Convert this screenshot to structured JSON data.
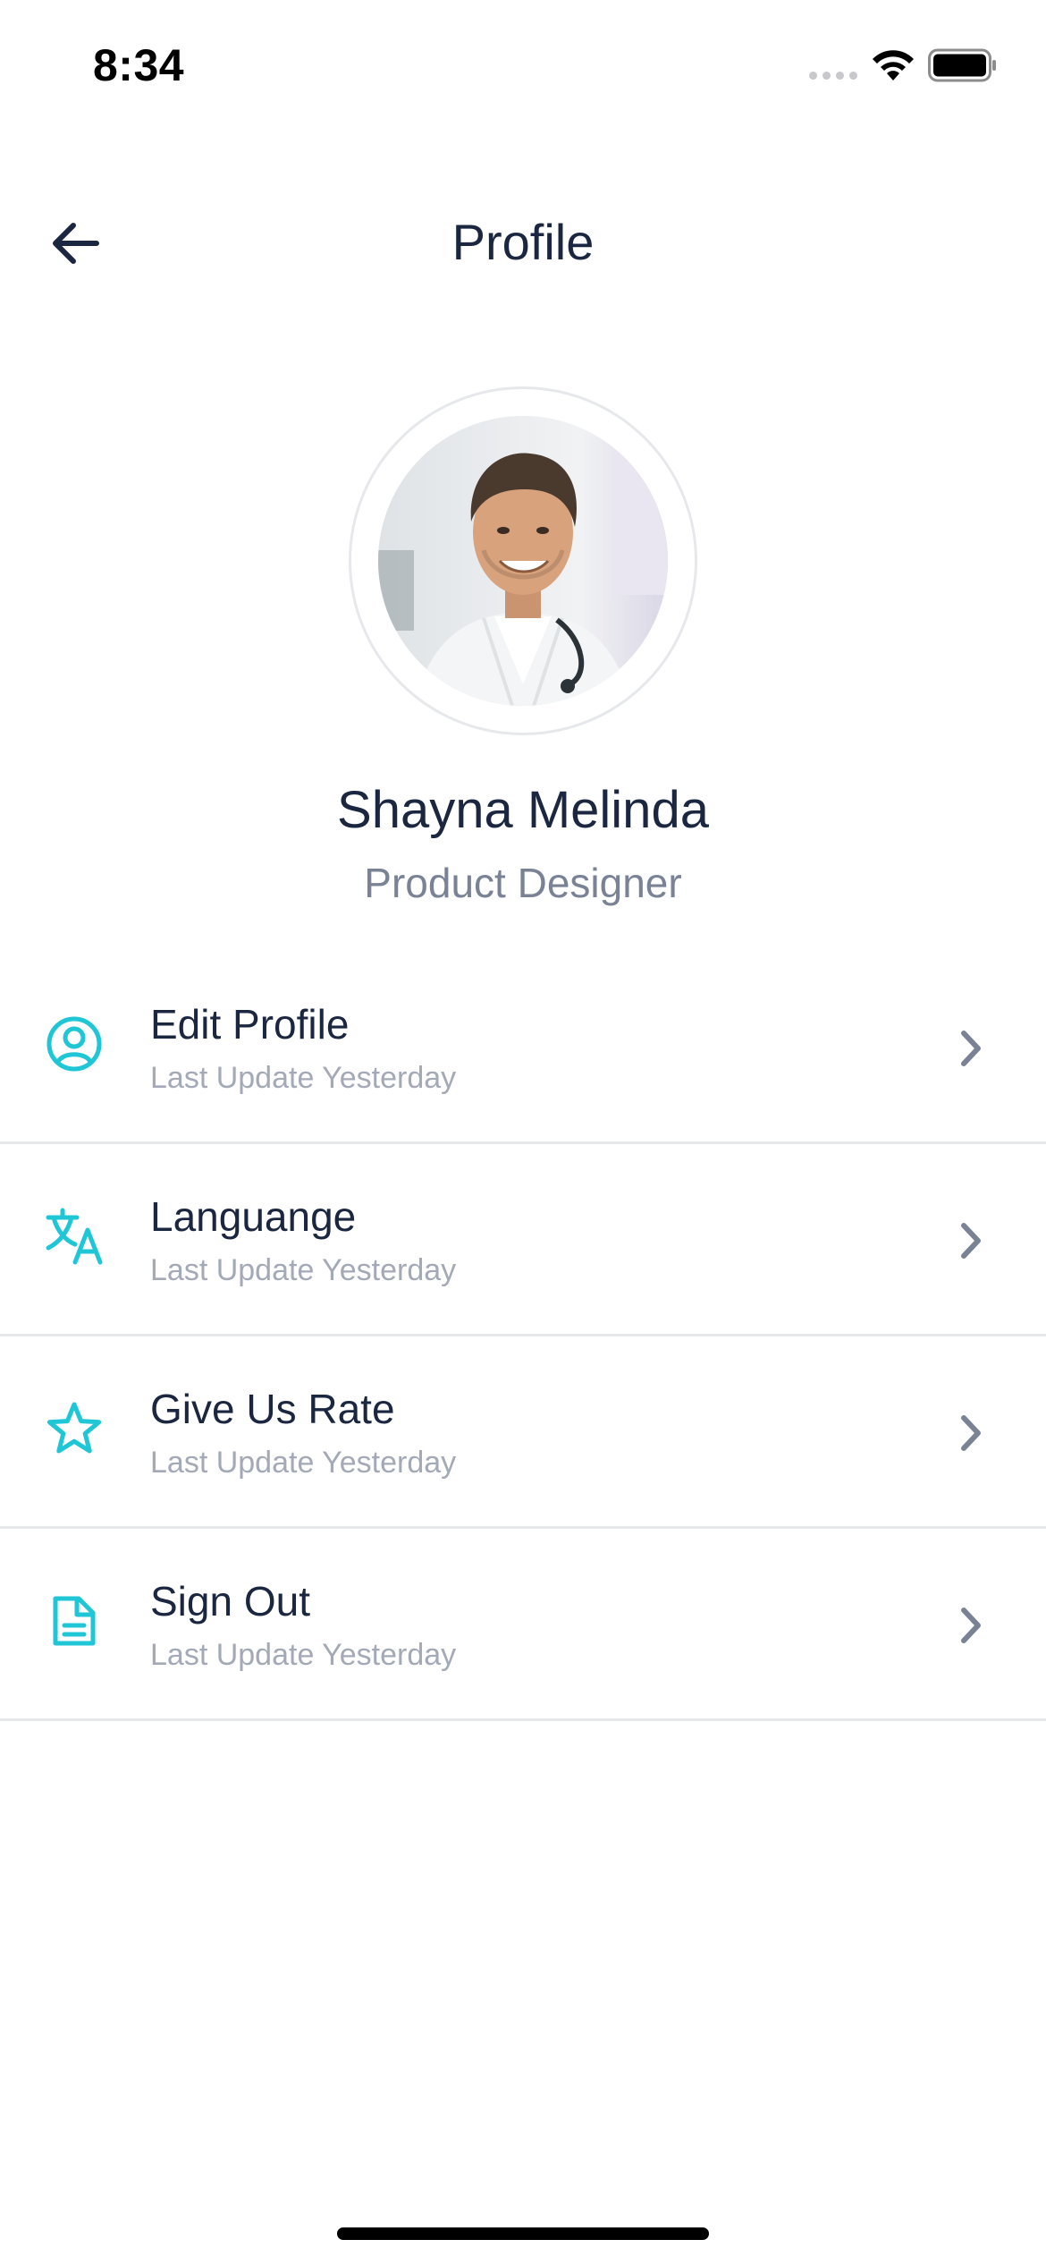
{
  "status_bar": {
    "time": "8:34"
  },
  "header": {
    "title": "Profile"
  },
  "profile": {
    "name": "Shayna Melinda",
    "role": "Product Designer"
  },
  "menu": {
    "items": [
      {
        "title": "Edit Profile",
        "subtitle": "Last Update Yesterday",
        "icon": "user-circle-icon"
      },
      {
        "title": "Languange",
        "subtitle": "Last Update Yesterday",
        "icon": "translate-icon"
      },
      {
        "title": "Give Us Rate",
        "subtitle": "Last Update Yesterday",
        "icon": "star-icon"
      },
      {
        "title": "Sign Out",
        "subtitle": "Last Update Yesterday",
        "icon": "document-icon"
      }
    ]
  },
  "colors": {
    "accent": "#1fc6d6",
    "text_primary": "#1b2640",
    "text_secondary": "#7a8396"
  }
}
